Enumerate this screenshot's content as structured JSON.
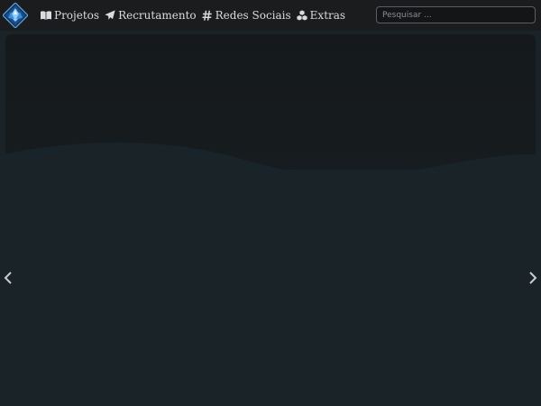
{
  "navbar": {
    "logo_icon": "diamond-crystal-logo-icon",
    "links": [
      {
        "label": "Projetos",
        "icon": "book-open-icon"
      },
      {
        "label": "Recrutamento",
        "icon": "paper-plane-icon"
      },
      {
        "label": "Redes Sociais",
        "icon": "hashtag-icon"
      },
      {
        "label": "Extras",
        "icon": "cubes-icon"
      }
    ],
    "search": {
      "placeholder": "Pesquisar ...",
      "value": ""
    }
  },
  "hero": {
    "prev_icon": "chevron-left-icon",
    "next_icon": "chevron-right-icon"
  },
  "colors": {
    "navbar_bg": "#1b1c1e",
    "hero_top": "#15191b",
    "hero_bottom": "#1a2328",
    "link_text": "#d8dbe0",
    "logo_accent": "#2a7fd1"
  }
}
